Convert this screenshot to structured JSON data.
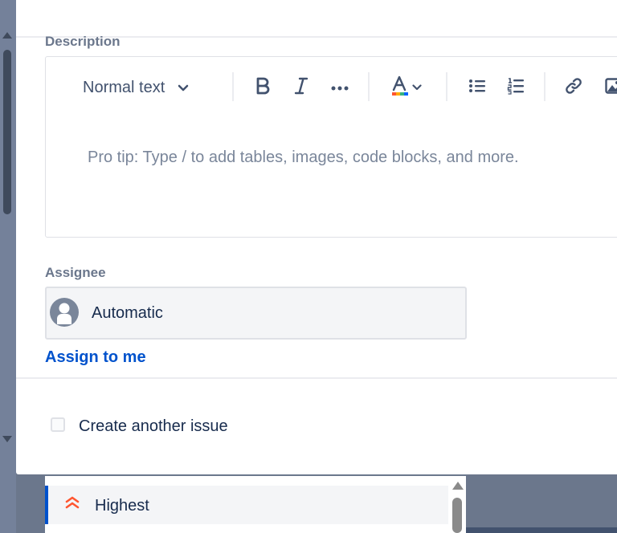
{
  "description": {
    "label": "Description",
    "toolbar": {
      "text_style": "Normal text"
    },
    "placeholder": "Pro tip: Type / to add tables, images, code blocks, and more."
  },
  "assignee": {
    "label": "Assignee",
    "value": "Automatic",
    "assign_to_me": "Assign to me"
  },
  "footer": {
    "create_another_label": "Create another issue",
    "create_another_checked": false
  },
  "priority_dropdown": {
    "highlighted_option": "Highest",
    "icon_color": "#ff5630"
  },
  "colors": {
    "link": "#0052cc",
    "label": "#6b778c",
    "text": "#172b4d",
    "icon": "#42526e"
  }
}
